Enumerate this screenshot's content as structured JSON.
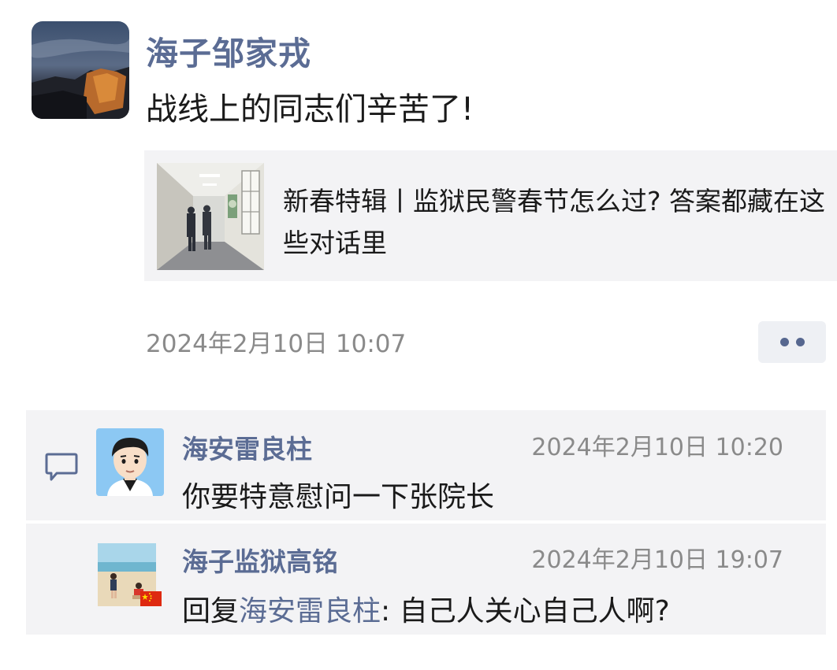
{
  "post": {
    "author": "海子邹家戎",
    "text": "战线上的同志们辛苦了!",
    "time": "2024年2月10日 10:07",
    "link": {
      "title": "新春特辑丨监狱民警春节怎么过? 答案都藏在这些对话里"
    }
  },
  "comments": [
    {
      "author": "海安雷良柱",
      "time": "2024年2月10日 10:20",
      "text": "你要特意慰问一下张院长"
    },
    {
      "author": "海子监狱高铭",
      "time": "2024年2月10日 19:07",
      "reply_prefix": "回复",
      "reply_to": "海安雷良柱",
      "text": ": 自己人关心自己人啊?"
    }
  ],
  "icons": {
    "comment": "speech-bubble-icon",
    "more": "more-dots-icon",
    "flag": "china-flag-icon"
  },
  "colors": {
    "name_blue": "#5b6c94",
    "time_gray": "#8a8a8a",
    "card_bg": "#f3f3f5"
  }
}
